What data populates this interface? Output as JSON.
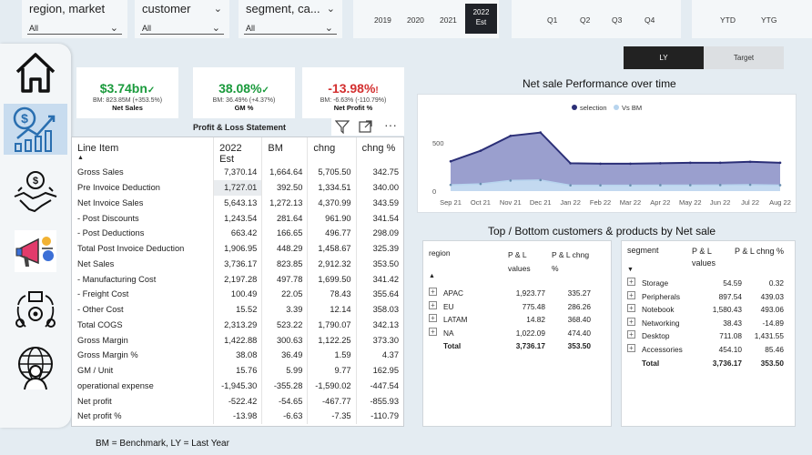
{
  "slicers": [
    {
      "title": "region, market",
      "value": "All"
    },
    {
      "title": "customer",
      "value": "All"
    },
    {
      "title": "segment, ca...",
      "value": "All"
    }
  ],
  "years": [
    "2019",
    "2020",
    "2021"
  ],
  "year_selected": {
    "year": "2022",
    "sub": "Est"
  },
  "quarters": [
    "Q1",
    "Q2",
    "Q3",
    "Q4"
  ],
  "periods": [
    "YTD",
    "YTG"
  ],
  "toggle": {
    "ly": "LY",
    "target": "Target"
  },
  "kpis": [
    {
      "value": "$3.74bn",
      "mark": "✓",
      "bm": "BM: 823.85M (+353.5%)",
      "label": "Net Sales",
      "color": "#1a9a3c"
    },
    {
      "value": "38.08%",
      "mark": "✓",
      "bm": "BM: 36.49% (+4.37%)",
      "label": "GM %",
      "color": "#1a9a3c"
    },
    {
      "value": "-13.98%",
      "mark": "!",
      "bm": "BM: -6.63% (-110.79%)",
      "label": "Net Profit %",
      "color": "#d32f2f"
    }
  ],
  "pl": {
    "title": "Profit & Loss Statement",
    "headers": [
      "Line Item",
      "2022 Est",
      "BM",
      "chng",
      "chng %"
    ],
    "rows": [
      [
        "Gross Sales",
        "7,370.14",
        "1,664.64",
        "5,705.50",
        "342.75"
      ],
      [
        "Pre Invoice Deduction",
        "1,727.01",
        "392.50",
        "1,334.51",
        "340.00"
      ],
      [
        "Net Invoice Sales",
        "5,643.13",
        "1,272.13",
        "4,370.99",
        "343.59"
      ],
      [
        "- Post Discounts",
        "1,243.54",
        "281.64",
        "961.90",
        "341.54"
      ],
      [
        "- Post Deductions",
        "663.42",
        "166.65",
        "496.77",
        "298.09"
      ],
      [
        "Total Post Invoice Deduction",
        "1,906.95",
        "448.29",
        "1,458.67",
        "325.39"
      ],
      [
        "Net Sales",
        "3,736.17",
        "823.85",
        "2,912.32",
        "353.50"
      ],
      [
        "- Manufacturing Cost",
        "2,197.28",
        "497.78",
        "1,699.50",
        "341.42"
      ],
      [
        "- Freight Cost",
        "100.49",
        "22.05",
        "78.43",
        "355.64"
      ],
      [
        "- Other Cost",
        "15.52",
        "3.39",
        "12.14",
        "358.03"
      ],
      [
        "Total COGS",
        "2,313.29",
        "523.22",
        "1,790.07",
        "342.13"
      ],
      [
        "Gross Margin",
        "1,422.88",
        "300.63",
        "1,122.25",
        "373.30"
      ],
      [
        "Gross Margin %",
        "38.08",
        "36.49",
        "1.59",
        "4.37"
      ],
      [
        "GM / Unit",
        "15.76",
        "5.99",
        "9.77",
        "162.95"
      ],
      [
        "operational expense",
        "-1,945.30",
        "-355.28",
        "-1,590.02",
        "-447.54"
      ],
      [
        "Net profit",
        "-522.42",
        "-54.65",
        "-467.77",
        "-855.93"
      ],
      [
        "Net profit %",
        "-13.98",
        "-6.63",
        "-7.35",
        "-110.79"
      ]
    ]
  },
  "chart_data": {
    "type": "area",
    "title": "Net sale Performance over time",
    "categories": [
      "Sep 21",
      "Oct 21",
      "Nov 21",
      "Dec 21",
      "Jan 22",
      "Feb 22",
      "Mar 22",
      "Apr 22",
      "May 22",
      "Jun 22",
      "Jul 22",
      "Aug 22"
    ],
    "series": [
      {
        "name": "selection",
        "color": "#2b2f77",
        "values": [
          310,
          420,
          575,
          610,
          290,
          285,
          285,
          290,
          295,
          295,
          305,
          295
        ]
      },
      {
        "name": "Vs BM",
        "color": "#b7d4ee",
        "values": [
          65,
          75,
          110,
          115,
          60,
          60,
          60,
          62,
          62,
          63,
          66,
          62
        ]
      }
    ],
    "yticks": [
      0,
      500
    ],
    "ylim": [
      0,
      720
    ],
    "legend": "top-center"
  },
  "topbottom": {
    "title": "Top / Bottom customers & products by Net sale",
    "region": {
      "headers": [
        "region",
        "P & L values",
        "P & L chng %"
      ],
      "rows": [
        [
          "APAC",
          "1,923.77",
          "335.27"
        ],
        [
          "EU",
          "775.48",
          "286.26"
        ],
        [
          "LATAM",
          "14.82",
          "368.40"
        ],
        [
          "NA",
          "1,022.09",
          "474.40"
        ]
      ],
      "total": [
        "Total",
        "3,736.17",
        "353.50"
      ]
    },
    "segment": {
      "headers": [
        "segment",
        "P & L values",
        "P & L chng %"
      ],
      "rows": [
        [
          "Storage",
          "54.59",
          "0.32"
        ],
        [
          "Peripherals",
          "897.54",
          "439.03"
        ],
        [
          "Notebook",
          "1,580.43",
          "493.06"
        ],
        [
          "Networking",
          "38.43",
          "-14.89"
        ],
        [
          "Desktop",
          "711.08",
          "1,431.55"
        ],
        [
          "Accessories",
          "454.10",
          "85.46"
        ]
      ],
      "total": [
        "Total",
        "3,736.17",
        "353.50"
      ]
    }
  },
  "footer": "BM = Benchmark, LY = Last Year"
}
